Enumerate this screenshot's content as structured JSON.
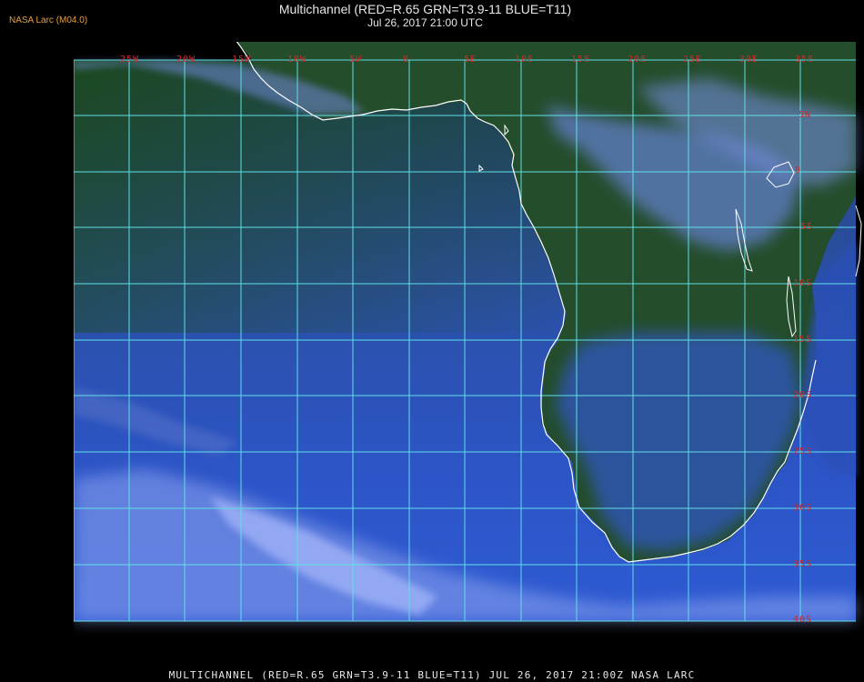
{
  "header": {
    "credit": "NASA Larc (M04.0)",
    "title": "Multichannel (RED=R.65 GRN=T3.9-11 BLUE=T11)",
    "subtitle": "Jul 26, 2017 21:00 UTC"
  },
  "map": {
    "projection": "cylindrical lat/lon grid, 5 degree spacing",
    "lon_labels": [
      "25W",
      "20W",
      "15W",
      "10W",
      "5W",
      "0",
      "5E",
      "10E",
      "15E",
      "20E",
      "25E",
      "30E",
      "35E"
    ],
    "lat_labels": [
      "5N",
      "0",
      "5S",
      "10S",
      "15S",
      "20S",
      "25S",
      "30S",
      "35S",
      "40S"
    ],
    "lon_range": [
      -30,
      35
    ],
    "lat_range": [
      -40,
      10
    ],
    "colors": {
      "ocean": "#2b4fb8",
      "land": "#1f4a1e",
      "cloud": "#9fb4ff",
      "grid": "#5fe0e6",
      "coast": "#ffffff",
      "tick_label": "#cc2a2a"
    },
    "regions_shown": [
      "West Africa coast",
      "Gulf of Guinea",
      "Southern Africa",
      "South Atlantic Ocean",
      "Lake Victoria",
      "Lake Tanganyika",
      "Lake Malawi",
      "Madagascar (partial)"
    ]
  },
  "footer": {
    "text": "MULTICHANNEL (RED=R.65 GRN=T3.9-11 BLUE=T11) JUL 26, 2017 21:00Z   NASA LARC"
  }
}
